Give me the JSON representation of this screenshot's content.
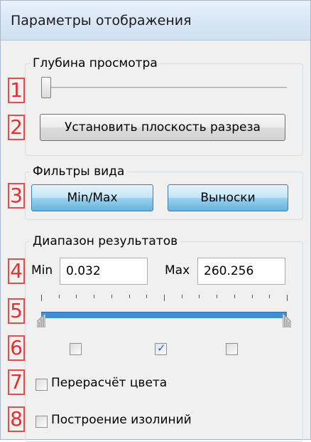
{
  "window": {
    "title": "Параметры отображения"
  },
  "annotations": [
    "1",
    "2",
    "3",
    "4",
    "5",
    "6",
    "7",
    "8"
  ],
  "depth_group": {
    "title": "Глубина просмотра",
    "slider_value": 0.0,
    "set_plane_button": "Установить плоскость разреза"
  },
  "filters_group": {
    "title": "Фильтры вида",
    "minmax_button": "Min/Max",
    "callouts_button": "Выноски"
  },
  "range_group": {
    "title": "Диапазон результатов",
    "min_label": "Min",
    "min_value": "0.032",
    "max_label": "Max",
    "max_value": "260.256",
    "range_low": 0.0,
    "range_high": 1.0,
    "checkboxes": [
      false,
      true,
      false
    ],
    "recalc_colors": {
      "label": "Перерасчёт цвета",
      "checked": false
    },
    "isolines": {
      "label": "Построение изолиний",
      "checked": false
    }
  },
  "colors": {
    "range_bar": "#3a8fd8",
    "annotation": "#e84b4b",
    "titlebar": "#dbe8f6"
  }
}
